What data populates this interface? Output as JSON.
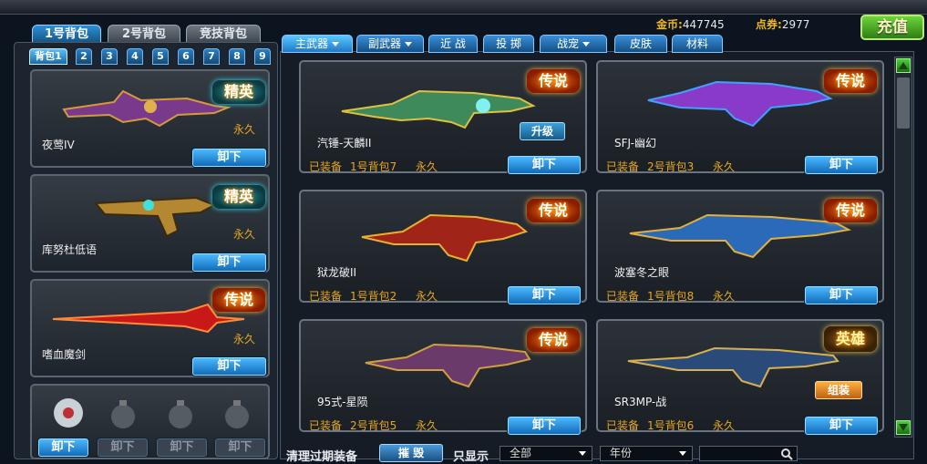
{
  "currency": {
    "gold_label": "金币:",
    "gold_value": "447745",
    "points_label": "点券:",
    "points_value": "2977",
    "recharge": "充值"
  },
  "bag_tabs": [
    "1号背包",
    "2号背包",
    "竞技背包"
  ],
  "sub_tabs": [
    "背包1",
    "2",
    "3",
    "4",
    "5",
    "6",
    "7",
    "8",
    "9"
  ],
  "categories": [
    "主武器",
    "副武器",
    "近 战",
    "投 掷",
    "战宠",
    "皮肤",
    "材料"
  ],
  "left_items": [
    {
      "name": "夜莺IV",
      "badge": "精英",
      "duration": "永久",
      "action": "卸下"
    },
    {
      "name": "库努杜低语",
      "badge": "精英",
      "duration": "永久",
      "action": "卸下"
    },
    {
      "name": "嗜血魔剑",
      "badge": "传说",
      "duration": "永久",
      "action": "卸下"
    }
  ],
  "grenade_slots": [
    "卸下",
    "卸下",
    "卸下",
    "卸下"
  ],
  "right_items": [
    {
      "name": "汽锤-天麟II",
      "badge": "传说",
      "extra": "升级",
      "equipped": "已装备",
      "bag": "1号背包7",
      "duration": "永久",
      "action": "卸下"
    },
    {
      "name": "SFJ-幽幻",
      "badge": "传说",
      "equipped": "已装备",
      "bag": "2号背包3",
      "duration": "永久",
      "action": "卸下"
    },
    {
      "name": "狱龙破II",
      "badge": "传说",
      "equipped": "已装备",
      "bag": "1号背包2",
      "duration": "永久",
      "action": "卸下"
    },
    {
      "name": "波塞冬之眼",
      "badge": "传说",
      "equipped": "已装备",
      "bag": "1号背包8",
      "duration": "永久",
      "action": "卸下"
    },
    {
      "name": "95式-星陨",
      "badge": "传说",
      "equipped": "已装备",
      "bag": "2号背包5",
      "duration": "永久",
      "action": "卸下"
    },
    {
      "name": "SR3MP-战",
      "badge": "英雄",
      "extra": "组装",
      "equipped": "已装备",
      "bag": "1号背包6",
      "duration": "永久",
      "action": "卸下"
    }
  ],
  "bottom": {
    "clean_label": "清理过期装备",
    "destroy": "摧 毁",
    "display_label": "只显示",
    "filter_all": "全部",
    "filter_year": "年份"
  }
}
